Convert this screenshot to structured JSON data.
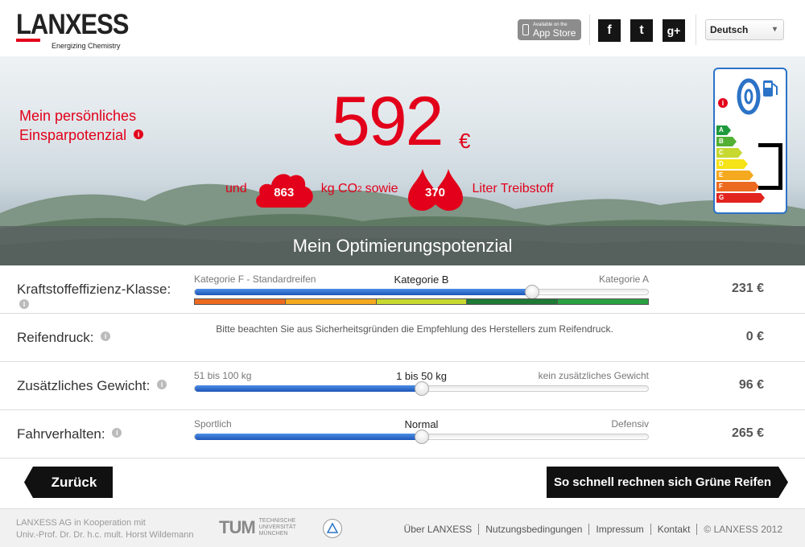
{
  "header": {
    "logo_text": "LANXESS",
    "logo_tagline": "Energizing Chemistry",
    "appstore_small": "Available on the",
    "appstore_big": "App Store",
    "social": [
      {
        "label": "f",
        "name": "facebook"
      },
      {
        "label": "t",
        "name": "twitter"
      },
      {
        "label": "g+",
        "name": "google-plus"
      }
    ],
    "language": "Deutsch"
  },
  "hero": {
    "headline_line1": "Mein persönliches",
    "headline_line2": "Einsparpotenzial",
    "amount": "592",
    "currency": "€",
    "prefix": "und",
    "co2_value": "863",
    "co2_unit_pre": "kg CO",
    "co2_sub": "2",
    "co2_unit_post": "sowie",
    "fuel_value": "370",
    "fuel_unit": "Liter Treibstoff"
  },
  "tire_label": {
    "classes": [
      {
        "letter": "A",
        "color": "#1e9a3c"
      },
      {
        "letter": "B",
        "color": "#53b034"
      },
      {
        "letter": "C",
        "color": "#c7d82f"
      },
      {
        "letter": "D",
        "color": "#f6e318"
      },
      {
        "letter": "E",
        "color": "#f4a91f"
      },
      {
        "letter": "F",
        "color": "#ec6a20"
      },
      {
        "letter": "G",
        "color": "#e2241f"
      }
    ]
  },
  "band": {
    "title": "Mein Optimierungspotenzial"
  },
  "rows": [
    {
      "label": "Kraftstoffeffizienz-Klasse:",
      "left": "Kategorie F - Standardreifen",
      "center": "Kategorie B",
      "right": "Kategorie A",
      "position_pct": 74.5,
      "value": "231 €"
    },
    {
      "label": "Reifendruck:",
      "note": "Bitte beachten Sie aus Sicherheitsgründen die Empfehlung des Herstellers zum Reifendruck.",
      "value": "0 €"
    },
    {
      "label": "Zusätzliches Gewicht:",
      "left": "51 bis 100 kg",
      "center": "1 bis 50 kg",
      "right": "kein zusätzliches Gewicht",
      "position_pct": 50,
      "value": "96 €"
    },
    {
      "label": "Fahrverhalten:",
      "left": "Sportlich",
      "center": "Normal",
      "right": "Defensiv",
      "position_pct": 50,
      "value": "265 €"
    }
  ],
  "efficiency_strip_colors": [
    "#ec6a20",
    "#f4a91f",
    "#c7d82f",
    "#1e7a35",
    "#2aa141"
  ],
  "buttons": {
    "back": "Zurück",
    "next": "So schnell rechnen sich Grüne Reifen"
  },
  "footer": {
    "text_line1": "LANXESS AG in Kooperation mit",
    "text_line2": "Univ.-Prof. Dr. Dr. h.c. mult. Horst Wildemann",
    "tum_logo": "TUM",
    "tum_text1": "TECHNISCHE",
    "tum_text2": "UNIVERSITÄT",
    "tum_text3": "MÜNCHEN",
    "links": [
      "Über LANXESS",
      "Nutzungsbedingungen",
      "Impressum",
      "Kontakt"
    ],
    "copyright": "© LANXESS 2012"
  },
  "colors": {
    "brand_red": "#e2001a",
    "slider_blue": "#1d55b8"
  }
}
